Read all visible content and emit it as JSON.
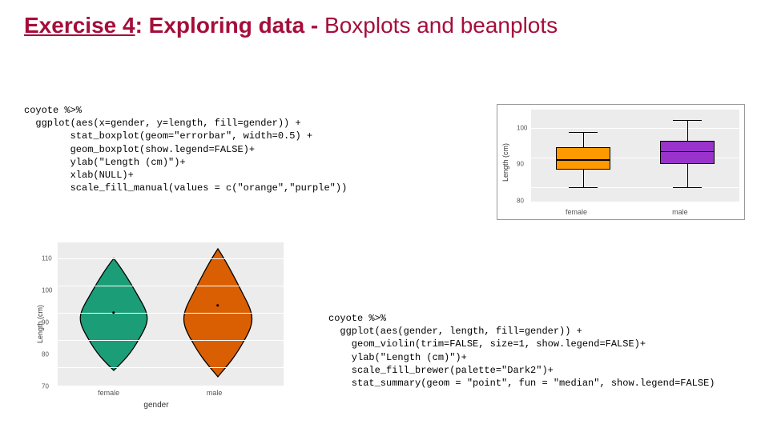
{
  "title": {
    "part1": "Exercise 4",
    "part2": ": Exploring data -",
    "part3": " Boxplots and beanplots"
  },
  "code1": {
    "l1": "coyote %>%",
    "l2": "  ggplot(aes(x=gender, y=length, fill=gender)) +",
    "l3": "        stat_boxplot(geom=\"errorbar\", width=0.5) +",
    "l4": "        geom_boxplot(show.legend=FALSE)+",
    "l5": "        ylab(\"Length (cm)\")+",
    "l6": "        xlab(NULL)+",
    "l7": "        scale_fill_manual(values = c(\"orange\",\"purple\"))"
  },
  "code2": {
    "l1": "coyote %>%",
    "l2": "  ggplot(aes(gender, length, fill=gender)) +",
    "l3": "    geom_violin(trim=FALSE, size=1, show.legend=FALSE)+",
    "l4": "    ylab(\"Length (cm)\")+",
    "l5": "    scale_fill_brewer(palette=\"Dark2\")+",
    "l6": "    stat_summary(geom = \"point\", fun = \"median\", show.legend=FALSE)"
  },
  "boxplot": {
    "ylabel": "Length (cm)",
    "xlabels": [
      "female",
      "male"
    ],
    "yticks": [
      "80",
      "90",
      "100"
    ],
    "colors": {
      "female": "#ff9900",
      "male": "#9933cc"
    }
  },
  "violin": {
    "ylabel": "Length (cm)",
    "xaxis_title": "gender",
    "xlabels": [
      "female",
      "male"
    ],
    "yticks": [
      "70",
      "80",
      "90",
      "100",
      "110"
    ],
    "colors": {
      "female": "#1b9e77",
      "male": "#d95f02"
    }
  },
  "chart_data": [
    {
      "type": "boxplot",
      "title": "",
      "xlabel": "",
      "ylabel": "Length (cm)",
      "ylim": [
        75,
        105
      ],
      "categories": [
        "female",
        "male"
      ],
      "series": [
        {
          "name": "female",
          "min": 80,
          "q1": 86,
          "median": 89,
          "q3": 93,
          "max": 98,
          "fill": "orange"
        },
        {
          "name": "male",
          "min": 80,
          "q1": 88,
          "median": 92,
          "q3": 95,
          "max": 102,
          "fill": "purple"
        }
      ]
    },
    {
      "type": "violin",
      "title": "",
      "xlabel": "gender",
      "ylabel": "Length (cm)",
      "ylim": [
        65,
        115
      ],
      "categories": [
        "female",
        "male"
      ],
      "series": [
        {
          "name": "female",
          "median": 89,
          "range": [
            72,
            106
          ],
          "fill": "#1b9e77"
        },
        {
          "name": "male",
          "median": 92,
          "range": [
            70,
            113
          ],
          "fill": "#d95f02"
        }
      ]
    }
  ]
}
